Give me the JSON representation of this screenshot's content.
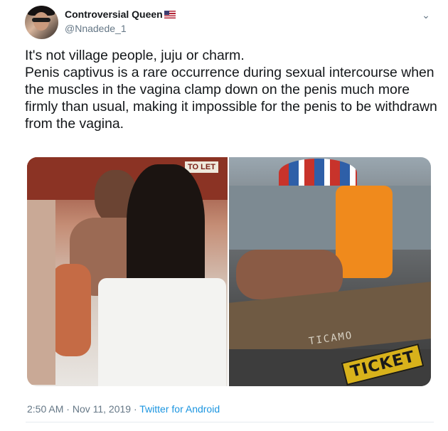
{
  "user": {
    "name": "Controversial Queen",
    "flag_icon": "us-flag-icon",
    "handle": "@Nnadede_1"
  },
  "menu": {
    "icon": "chevron-down-icon",
    "glyph": "⌄"
  },
  "tweet": {
    "lines": [
      "It's not village people, juju or charm.",
      "Penis captivus is a rare occurrence during sexual intercourse when the muscles in the vagina clamp down on the penis much more firmly than usual, making it impossible for the penis to be withdrawn from the vagina."
    ]
  },
  "media": {
    "left_sign": "TO LET",
    "right_wood_text": "TICAMO",
    "watermark": "TICKET"
  },
  "footer": {
    "time": "2:50 AM",
    "separator1": " · ",
    "date": "Nov 11, 2019",
    "separator2": " · ",
    "source": "Twitter for Android"
  },
  "colors": {
    "text": "#14171a",
    "muted": "#657786",
    "link": "#1b95e0"
  }
}
